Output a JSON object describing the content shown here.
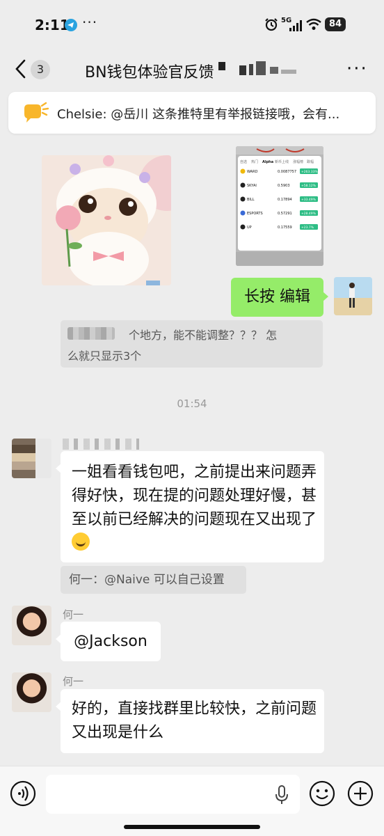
{
  "status_bar": {
    "time": "2:11",
    "more": "···",
    "network": "5G",
    "battery": "84"
  },
  "header": {
    "back_count": "3",
    "title": "BN钱包体验官反馈",
    "more": "···"
  },
  "pinned": {
    "text": "Chelsie: @岳川 这条推特里有举报链接哦，会有..."
  },
  "messages": {
    "self_message": "长按 编辑",
    "quote1_line1": "个地方，能不能调整？？？    怎",
    "quote1_line2": "么就只显示3个",
    "timestamp": "01:54",
    "msg2": "一姐看看钱包吧，之前提出来问题弄得好快，现在提的问题处理好慢，甚至以前已经解决的问题现在又出现了",
    "quote2": "何一：@Naive 可以自己设置",
    "sender_a": "何一",
    "msg3": "@Jackson",
    "sender_b": "何一",
    "msg4": "好的，直接找群里比较快，之前问题又出现是什么"
  },
  "screenshot_thumb": {
    "tabs": [
      "自选",
      "热门",
      "Alpha",
      "新币上线",
      "涨幅榜",
      "跌幅"
    ],
    "rows": [
      {
        "name": "WARD",
        "price": "0.0087757",
        "change": "+263.33%"
      },
      {
        "name": "SKYAI",
        "price": "0.5903",
        "change": "+58.12%"
      },
      {
        "name": "BILL",
        "price": "0.17894",
        "change": "+33.49%"
      },
      {
        "name": "ESPORTS",
        "price": "0.57291",
        "change": "+28.49%"
      },
      {
        "name": "UP",
        "price": "0.17559",
        "change": "+23.7%"
      }
    ]
  },
  "colors": {
    "accent_green": "#95ec69",
    "change_green": "#2ebd85",
    "background": "#ededed"
  },
  "icons": [
    "back-chevron-icon",
    "more-icon",
    "announcement-icon",
    "voice-icon",
    "mic-icon",
    "emoji-icon",
    "plus-icon"
  ]
}
